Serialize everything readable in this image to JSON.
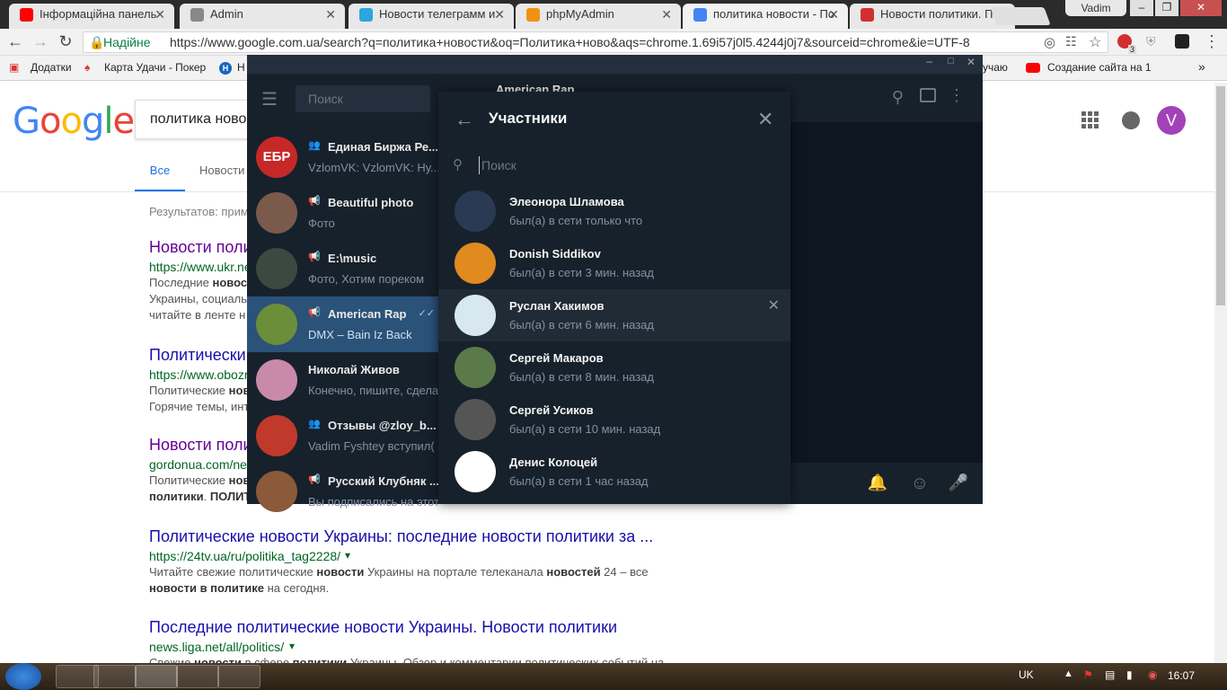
{
  "browser": {
    "tabs": [
      {
        "title": "Інформаційна панель",
        "favicon_color": "#ff0000"
      },
      {
        "title": "Admin",
        "favicon_color": "#888888"
      },
      {
        "title": "Новости телеграмм и",
        "favicon_color": "#2ca5e0"
      },
      {
        "title": "phpMyAdmin",
        "favicon_color": "#f29111"
      },
      {
        "title": "политика новости - По",
        "favicon_color": "#4285f4"
      },
      {
        "title": "Новости политики. По",
        "favicon_color": "#d32f2f"
      }
    ],
    "profile_name": "Vadim",
    "secure_label": "Надійне",
    "url": "https://www.google.com.ua/search?q=политика+новости&oq=Политика+ново&aqs=chrome.1.69i57j0l5.4244j0j7&sourceid=chrome&ie=UTF-8",
    "extension_badge": "3",
    "bookmarks": [
      {
        "label": "Додатки"
      },
      {
        "label": "Карта Удачи - Покер"
      },
      {
        "label": "Н"
      },
      {
        "label": "учаю"
      },
      {
        "label": "Создание сайта на 1"
      }
    ],
    "bookmarks_more": "»"
  },
  "google": {
    "logo": [
      {
        "ch": "G",
        "color": "#4285f4"
      },
      {
        "ch": "o",
        "color": "#ea4335"
      },
      {
        "ch": "o",
        "color": "#fbbc05"
      },
      {
        "ch": "g",
        "color": "#4285f4"
      },
      {
        "ch": "l",
        "color": "#34a853"
      },
      {
        "ch": "e",
        "color": "#ea4335"
      }
    ],
    "query": "политика ново",
    "tabs": {
      "all": "Все",
      "news": "Новости"
    },
    "stats": "Результатов: прим",
    "avatar_letter": "V",
    "results": [
      {
        "title": "Новости поли",
        "url": "https://www.ukr.ne",
        "snippet": [
          "Последние новост",
          "Украины, социаль",
          "читайте в ленте н"
        ]
      },
      {
        "title": "Политически",
        "url": "https://www.obozr",
        "snippet": [
          "Политические нов",
          "Горячие темы, инт"
        ]
      },
      {
        "title": "Новости поли",
        "url": "gordonua.com/ne",
        "snippet": [
          "Политические нов",
          "политики. ПОЛИТ"
        ]
      },
      {
        "title": "Политические новости Украины: последние новости политики за ...",
        "url": "https://24tv.ua/ru/politika_tag2228/",
        "snippet": [
          "Читайте свежие политические новости Украины на портале телеканала новостей 24 – все",
          "новости в политике на сегодня."
        ]
      },
      {
        "title": "Последние политические новости Украины. Новости политики",
        "url": "news.liga.net/all/politics/",
        "snippet": [
          "Свежие новости в сфере политики Украины. Обзор и комментарии политических событий на"
        ]
      }
    ]
  },
  "telegram": {
    "search_placeholder": "Поиск",
    "active_chat_title": "American Rap",
    "chats": [
      {
        "name": "Единая Биржа Ре...",
        "message": "VzlomVK: VzlomVK: Ну...",
        "avatar_text": "ЕБР",
        "avatar_color": "#c62828",
        "type": "group"
      },
      {
        "name": "Beautiful photo",
        "message": "Фото",
        "avatar_text": "",
        "avatar_color": "#7a5a4a",
        "type": "channel"
      },
      {
        "name": "E:\\music",
        "message": "Фото, Хотим пореком",
        "avatar_text": "",
        "avatar_color": "#3a4a40",
        "type": "channel"
      },
      {
        "name": "American Rap",
        "message": "DMX – Bain Iz Back",
        "avatar_text": "",
        "avatar_color": "#6b8e3a",
        "type": "channel"
      },
      {
        "name": "Николай Живов",
        "message": "Конечно, пишите, сдела",
        "avatar_text": "",
        "avatar_color": "#c88aa8",
        "type": "user"
      },
      {
        "name": "Отзывы @zloy_b...",
        "message": "Vadim Fyshtey вступил(",
        "avatar_text": "",
        "avatar_color": "#c0392b",
        "type": "group"
      },
      {
        "name": "Русский Клубняк ...",
        "message": "Вы подписались на этот",
        "avatar_text": "",
        "avatar_color": "#8a5a3a",
        "type": "channel"
      }
    ],
    "members_panel": {
      "title": "Участники",
      "search_placeholder": "Поиск",
      "members": [
        {
          "name": "Элеонора Шламова",
          "status": "был(а) в сети только что",
          "avatar_color": "#2a3a55"
        },
        {
          "name": "Donish Siddikov",
          "status": "был(а) в сети 3 мин. назад",
          "avatar_color": "#e08a20"
        },
        {
          "name": "Руслан Хакимов",
          "status": "был(а) в сети 6 мин. назад",
          "avatar_color": "#d8e8f0"
        },
        {
          "name": "Сергей Макаров",
          "status": "был(а) в сети 8 мин. назад",
          "avatar_color": "#5a7a4a"
        },
        {
          "name": "Сергей Усиков",
          "status": "был(а) в сети 10 мин. назад",
          "avatar_color": "#555555"
        },
        {
          "name": "Денис Колоцей",
          "status": "был(а) в сети 1 час назад",
          "avatar_color": "#ffffff"
        }
      ]
    }
  },
  "taskbar": {
    "language": "UK",
    "time": "16:07"
  }
}
